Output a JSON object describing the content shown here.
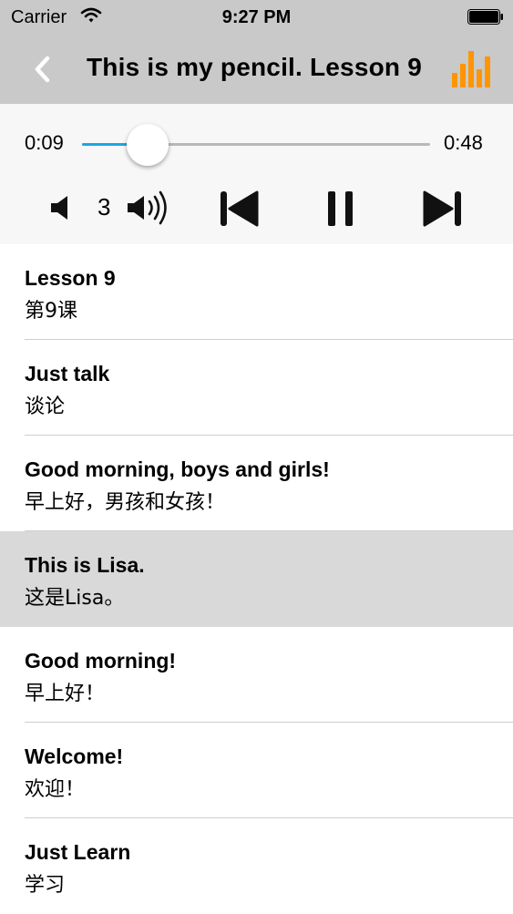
{
  "status_bar": {
    "carrier": "Carrier",
    "time": "9:27 PM"
  },
  "nav": {
    "title": "This is my pencil. Lesson 9",
    "accent_color": "#ff9500"
  },
  "player": {
    "current_time": "0:09",
    "total_time": "0:48",
    "progress_fraction": 0.1875,
    "volume_level": "3",
    "progress_color": "#1aa6e6",
    "icons": [
      "volume-down-icon",
      "volume-up-icon",
      "skip-previous-icon",
      "pause-icon",
      "skip-next-icon"
    ]
  },
  "list": {
    "selected_index": 3,
    "items": [
      {
        "en": "Lesson 9",
        "zh": "第9课"
      },
      {
        "en": "Just talk",
        "zh": "谈论"
      },
      {
        "en": "Good morning, boys and girls!",
        "zh": "早上好，男孩和女孩！"
      },
      {
        "en": "This is Lisa.",
        "zh": "这是Lisa。"
      },
      {
        "en": "Good morning!",
        "zh": "早上好！"
      },
      {
        "en": "Welcome!",
        "zh": "欢迎！"
      },
      {
        "en": "Just Learn",
        "zh": "学习"
      }
    ]
  }
}
